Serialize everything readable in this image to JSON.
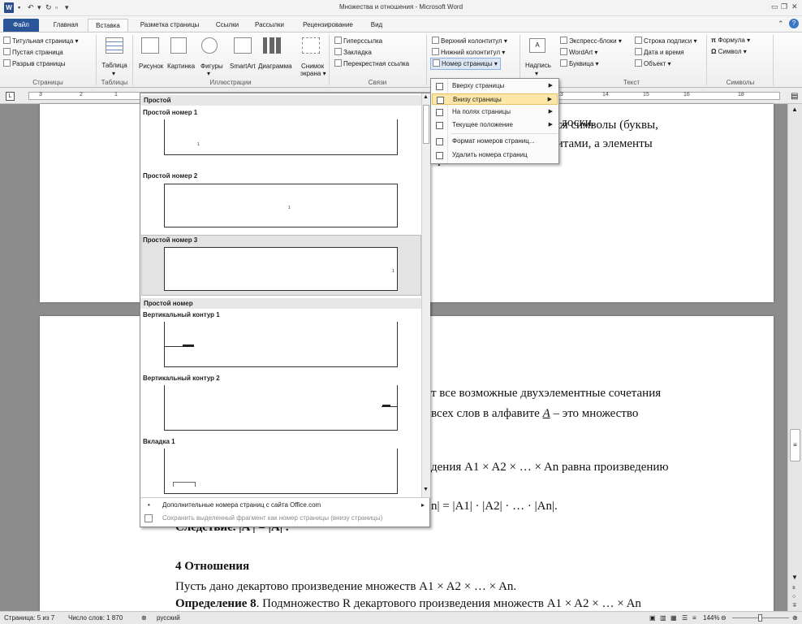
{
  "window": {
    "title": "Множества и отношения - Microsoft Word",
    "app_icon": "W"
  },
  "tabs": [
    "Файл",
    "Главная",
    "Вставка",
    "Разметка страницы",
    "Ссылки",
    "Рассылки",
    "Рецензирование",
    "Вид"
  ],
  "ribbon": {
    "pages": {
      "title_page": "Титульная страница",
      "blank_page": "Пустая страница",
      "page_break": "Разрыв страницы",
      "label": "Страницы"
    },
    "tables": {
      "table": "Таблица",
      "label": "Таблицы"
    },
    "illustrations": {
      "picture": "Рисунок",
      "clipart": "Картинка",
      "shapes": "Фигуры",
      "smartart": "SmartArt",
      "chart": "Диаграмма",
      "screenshot_1": "Снимок",
      "screenshot_2": "экрана",
      "label": "Иллюстрации"
    },
    "links": {
      "hyperlink": "Гиперссылка",
      "bookmark": "Закладка",
      "crossref": "Перекрестная ссылка",
      "label": "Связи"
    },
    "header_footer": {
      "header": "Верхний колонтитул",
      "footer": "Нижний колонтитул",
      "page_number": "Номер страницы"
    },
    "text": {
      "textbox": "Надпись",
      "quickparts": "Экспресс-блоки",
      "wordart": "WordArt",
      "dropcap": "Буквица",
      "sigline": "Строка подписи",
      "datetime": "Дата и время",
      "object": "Объект",
      "label": "Текст"
    },
    "symbols": {
      "equation": "Формула",
      "symbol": "Символ",
      "label": "Символы"
    }
  },
  "ruler_numbers": [
    "3",
    "2",
    "1",
    "13",
    "14",
    "15",
    "16",
    "18"
  ],
  "gallery": {
    "header1": "Простой",
    "items": [
      "Простой номер 1",
      "Простой номер 2",
      "Простой номер 3"
    ],
    "header2": "Простой номер",
    "items2": [
      "Вертикальный контур 1",
      "Вертикальный контур 2",
      "Вкладка 1"
    ],
    "tab_label": "1",
    "footer": [
      "Дополнительные номера страниц с сайта Office.com",
      "Сохранить выделенный фрагмент как номер страницы (внизу страницы)"
    ]
  },
  "submenu": {
    "items": [
      "Вверху страницы",
      "Внизу страницы",
      "На полях страницы",
      "Текущее положение",
      "Формат номеров страниц...",
      "Удалить номера страниц"
    ]
  },
  "document": {
    "p1_l1": "ой доски.",
    "p1_l2": "отся символы (буквы,",
    "p1_l3": "авитами, а элементы",
    "p1_l4": "фавите A.",
    "p2_l1": "т все возможные двухэлементные сочетания",
    "p2_l2a": "всех слов в алфавите ",
    "p2_l2b": "A",
    "p2_l2c": " – это множество",
    "p2_l3": "дения A1 × A2 × … × An равна произведению",
    "p2_l4": "n| = |A1| · |A2| · … · |An|.",
    "p2_l5": "Следствие. |A | = |A| .",
    "h4": "4 Отношения",
    "p3": "Пусть дано декартово произведение множеств A1 × A2 × … × An.",
    "def_bold": "Определение 8",
    "def_rest": ". Подмножество R декартового произведения множеств A1 × A2 × … × An"
  },
  "status": {
    "page": "Страница: 5 из 7",
    "words": "Число слов: 1 870",
    "lang": "русский",
    "zoom": "144%"
  }
}
